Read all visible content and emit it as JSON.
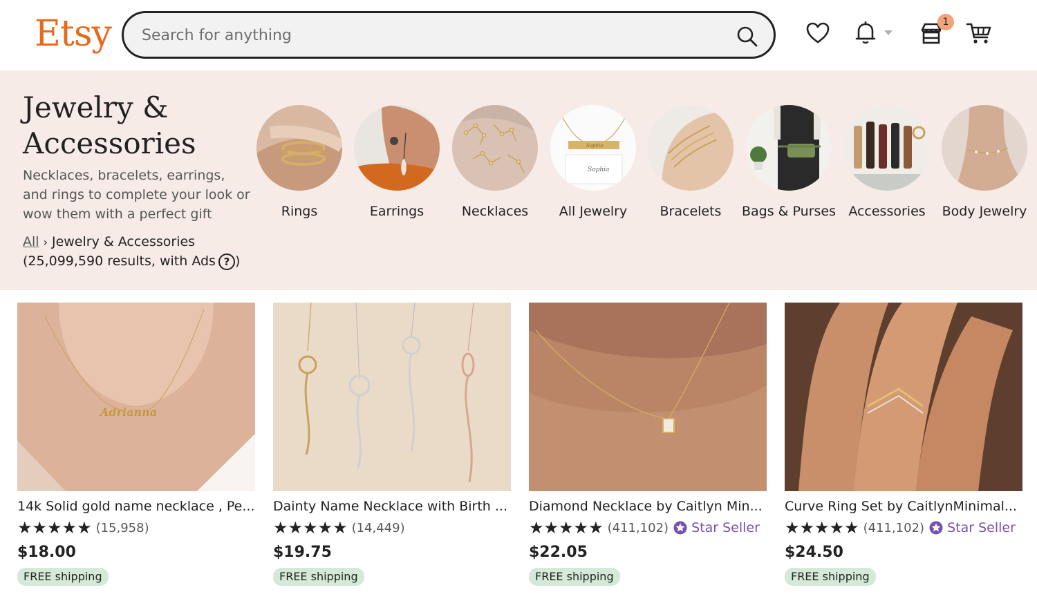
{
  "header": {
    "logo": "Etsy",
    "search_placeholder": "Search for anything",
    "cart_badge": "1"
  },
  "category": {
    "title": "Jewelry & Accessories",
    "description": "Necklaces, bracelets, earrings, and rings to complete your look or wow them with a perfect gift",
    "breadcrumb_root": "All",
    "breadcrumb_current": "Jewelry & Accessories",
    "results": "(25,099,590 results, with Ads",
    "results_close": ")",
    "subcategories": [
      {
        "label": "Rings",
        "icon": "ring-photo"
      },
      {
        "label": "Earrings",
        "icon": "earring-photo"
      },
      {
        "label": "Necklaces",
        "icon": "necklace-photo"
      },
      {
        "label": "All Jewelry",
        "icon": "bar-necklace-photo"
      },
      {
        "label": "Bracelets",
        "icon": "bracelet-photo"
      },
      {
        "label": "Bags & Purses",
        "icon": "belt-bag-photo"
      },
      {
        "label": "Accessories",
        "icon": "keychain-photo"
      },
      {
        "label": "Body Jewelry",
        "icon": "anklet-photo"
      }
    ]
  },
  "products": [
    {
      "title": "14k Solid gold name necklace , Pe...",
      "stars": "★★★★★",
      "reviews": "(15,958)",
      "star_seller": "",
      "price": "$18.00",
      "shipping": "FREE shipping"
    },
    {
      "title": "Dainty Name Necklace with Birth ...",
      "stars": "★★★★★",
      "reviews": "(14,449)",
      "star_seller": "",
      "price": "$19.75",
      "shipping": "FREE shipping"
    },
    {
      "title": "Diamond Necklace by Caitlyn Min...",
      "stars": "★★★★★",
      "reviews": "(411,102)",
      "star_seller": "Star Seller",
      "price": "$22.05",
      "shipping": "FREE shipping"
    },
    {
      "title": "Curve Ring Set by CaitlynMinimal...",
      "stars": "★★★★★",
      "reviews": "(411,102)",
      "star_seller": "Star Seller",
      "price": "$24.50",
      "shipping": "FREE shipping"
    }
  ],
  "colors": {
    "brand": "#e56a1c",
    "banner_bg": "#f6ebe7",
    "star_seller": "#7851a9",
    "free_shipping_bg": "#d4e9d7"
  }
}
